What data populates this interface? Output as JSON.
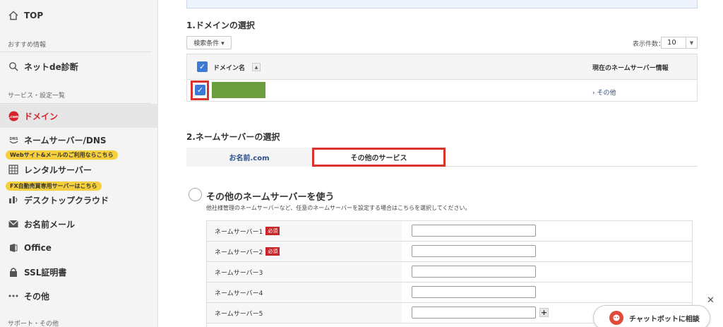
{
  "sidebar": {
    "top": {
      "label": "TOP",
      "icon": "home-icon"
    },
    "section_recommend": "おすすめ情報",
    "net_diag": {
      "label": "ネットde診断",
      "icon": "search-icon"
    },
    "section_services": "サービス・設定一覧",
    "domain": {
      "label": "ドメイン",
      "icon": "com-icon"
    },
    "nameserver": {
      "label": "ネームサーバー/DNS",
      "icon": "dns-icon"
    },
    "pill_web": "Webサイト&メールのご利用ならこちら",
    "rental": {
      "label": "レンタルサーバー",
      "icon": "server-icon"
    },
    "pill_fx": "FX自動売買専用サーバーはこちら",
    "desktop": {
      "label": "デスクトップクラウド",
      "icon": "cloud-icon"
    },
    "mail": {
      "label": "お名前メール",
      "icon": "mail-icon"
    },
    "office": {
      "label": "Office",
      "icon": "office-icon"
    },
    "ssl": {
      "label": "SSL証明書",
      "icon": "lock-icon"
    },
    "other": {
      "label": "その他",
      "icon": "dots-icon"
    },
    "section_support": "サポート・その他"
  },
  "domain_section": {
    "title": "1.ドメインの選択",
    "filter_button": "検索条件 ▾",
    "count_label": "表示件数：",
    "count_value": "10",
    "col_domain": "ドメイン名",
    "col_ns_info": "現在のネームサーバー情報",
    "row_link": "› その他"
  },
  "ns_section": {
    "title": "2.ネームサーバーの選択",
    "tab_onamae": "お名前.com",
    "tab_other": "その他のサービス",
    "option_title": "その他のネームサーバーを使う",
    "option_desc": "他社様管理のネームサーバーなど、任意のネームサーバーを設定する場合はこちらを選択してください。",
    "required_badge": "必須",
    "rows": [
      {
        "label": "ネームサーバー1",
        "required": true
      },
      {
        "label": "ネームサーバー2",
        "required": true
      },
      {
        "label": "ネームサーバー3",
        "required": false
      },
      {
        "label": "ネームサーバー4",
        "required": false
      },
      {
        "label": "ネームサーバー5",
        "required": false
      }
    ]
  },
  "chat": {
    "label": "チャットボットに相談"
  },
  "colors": {
    "accent_red": "#d9332b",
    "checkbox_blue": "#3d7ad6",
    "pill_yellow": "#f5cf3c"
  }
}
